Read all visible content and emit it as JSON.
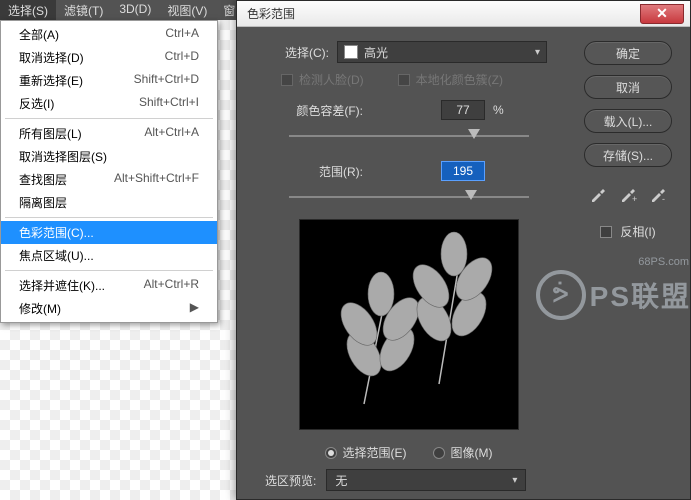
{
  "menubar": {
    "select": "选择(S)",
    "filter": "滤镜(T)",
    "threeD": "3D(D)",
    "view": "视图(V)",
    "window_frag": "窗"
  },
  "dropdown": {
    "all": {
      "label": "全部(A)",
      "sc": "Ctrl+A"
    },
    "deselect": {
      "label": "取消选择(D)",
      "sc": "Ctrl+D"
    },
    "reselect": {
      "label": "重新选择(E)",
      "sc": "Shift+Ctrl+D"
    },
    "inverse": {
      "label": "反选(I)",
      "sc": "Shift+Ctrl+I"
    },
    "allLayers": {
      "label": "所有图层(L)",
      "sc": "Alt+Ctrl+A"
    },
    "deselectLayers": {
      "label": "取消选择图层(S)",
      "sc": ""
    },
    "findLayers": {
      "label": "查找图层",
      "sc": "Alt+Shift+Ctrl+F"
    },
    "isolateLayers": {
      "label": "隔离图层",
      "sc": ""
    },
    "colorRange": {
      "label": "色彩范围(C)...",
      "sc": ""
    },
    "focusArea": {
      "label": "焦点区域(U)...",
      "sc": ""
    },
    "selectAndMask": {
      "label": "选择并遮住(K)...",
      "sc": "Alt+Ctrl+R"
    },
    "modify": {
      "label": "修改(M)",
      "sc": ""
    }
  },
  "dialog": {
    "title": "色彩范围",
    "selectLabel": "选择(C):",
    "selectValue": "高光",
    "detectFaces": "检测人脸(D)",
    "localized": "本地化颜色簇(Z)",
    "fuzzinessLabel": "颜色容差(F):",
    "fuzzinessValue": "77",
    "percent": "%",
    "rangeLabel": "范围(R):",
    "rangeValue": "195",
    "radioSelection": "选择范围(E)",
    "radioImage": "图像(M)",
    "previewLabel": "选区预览:",
    "previewValue": "无",
    "btnOK": "确定",
    "btnCancel": "取消",
    "btnLoad": "载入(L)...",
    "btnSave": "存储(S)...",
    "invert": "反相(I)"
  },
  "watermark": {
    "site": "68PS.com",
    "text": "PS联盟"
  }
}
